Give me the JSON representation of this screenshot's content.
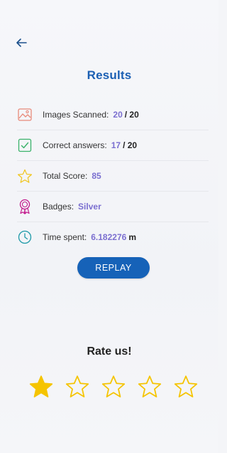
{
  "header": {
    "back_icon": "arrow-left-icon",
    "title": "Results"
  },
  "stats": [
    {
      "icon": "image-icon",
      "label": "Images Scanned:",
      "value": "20",
      "suffix": "/ 20",
      "icon_color": "#e88a7a"
    },
    {
      "icon": "checkbox-icon",
      "label": "Correct answers:",
      "value": "17",
      "suffix": "/ 20",
      "icon_color": "#3ab26a"
    },
    {
      "icon": "star-outline-icon",
      "label": "Total Score:",
      "value": "85",
      "suffix": "",
      "icon_color": "#f0c419"
    },
    {
      "icon": "badge-icon",
      "label": "Badges:",
      "value": "Silver",
      "suffix": "",
      "icon_color": "#c2188c"
    },
    {
      "icon": "clock-icon",
      "label": "Time spent:",
      "value": "6.182276",
      "suffix": "m",
      "icon_color": "#1e9aa8"
    }
  ],
  "replay_button": {
    "label": "REPLAY"
  },
  "rating": {
    "title": "Rate us!",
    "stars_total": 5,
    "stars_selected": 1,
    "star_color": "#f5c400"
  },
  "colors": {
    "accent": "#1662b8",
    "value": "#7b6fd0"
  }
}
